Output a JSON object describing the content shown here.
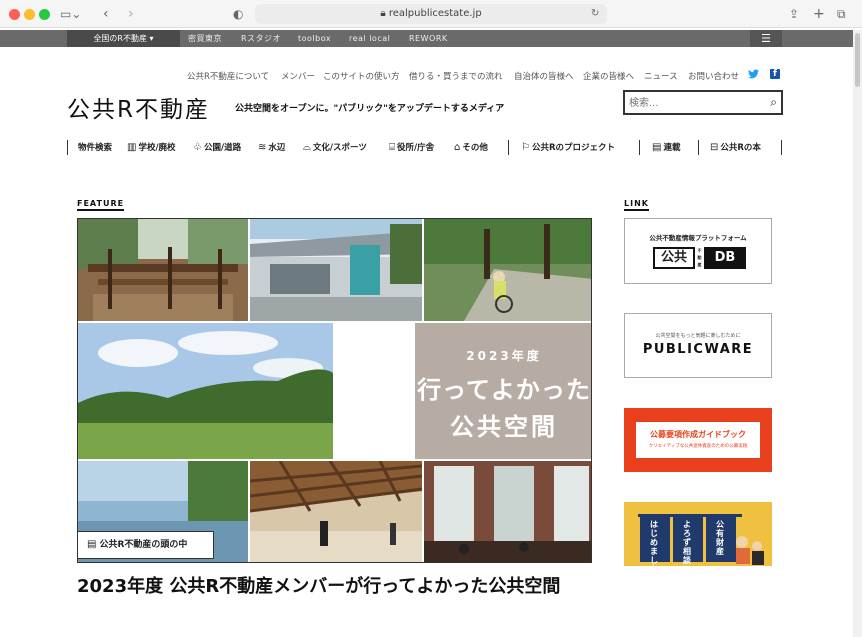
{
  "browser": {
    "url": "realpublicestate.jp"
  },
  "topbar": {
    "region": "全国のR不動産 ▾",
    "links": [
      "密買東京",
      "Rスタジオ",
      "toolbox",
      "real local",
      "REWORK"
    ],
    "menu": "☰"
  },
  "utility_links": [
    "公共R不動産について",
    "メンバー",
    "このサイトの使い方",
    "借りる・買うまでの流れ",
    "自治体の皆様へ",
    "企業の皆様へ",
    "ニュース",
    "お問い合わせ"
  ],
  "header": {
    "logo": "公共R不動産",
    "tagline": "公共空間をオープンに。\"パブリック\"をアップデートするメディア",
    "search_placeholder": "検索..."
  },
  "nav": {
    "property_search": "物件検索",
    "categories": [
      {
        "label": "学校/廃校",
        "icon": "school-icon"
      },
      {
        "label": "公園/道路",
        "icon": "park-icon"
      },
      {
        "label": "水辺",
        "icon": "waterside-icon"
      },
      {
        "label": "文化/スポーツ",
        "icon": "culture-icon"
      },
      {
        "label": "役所/庁舎",
        "icon": "government-icon"
      },
      {
        "label": "その他",
        "icon": "other-icon"
      }
    ],
    "projects": "公共Rのプロジェクト",
    "series": "連載",
    "books": "公共Rの本"
  },
  "feature": {
    "heading": "FEATURE",
    "card_year": "2023年度",
    "card_line1": "行ってよかった",
    "card_line2": "公共空間",
    "category_badge": "公共R不動産の頭の中",
    "title": "2023年度 公共R不動産メンバーが行ってよかった公共空間"
  },
  "link": {
    "heading": "LINK",
    "banners": [
      {
        "top": "公共不動産情報プラットフォーム",
        "left": "公共",
        "small": "不動産",
        "right": "DB"
      },
      {
        "top": "公共空間をもっと気軽に楽しむために",
        "main": "PUBLICWARE"
      },
      {
        "main": "公募要項作成ガイドブック",
        "sub": "クリエイティブな公共遊休資産のための公募実践"
      },
      {
        "labels": [
          "はじめました",
          "よろず相談",
          "公有財産"
        ]
      }
    ]
  },
  "colors": {
    "topbar": "#6a6a6a",
    "orange_banner": "#e8401c",
    "yellow_banner": "#f0c040",
    "navy": "#1f3a6b"
  }
}
